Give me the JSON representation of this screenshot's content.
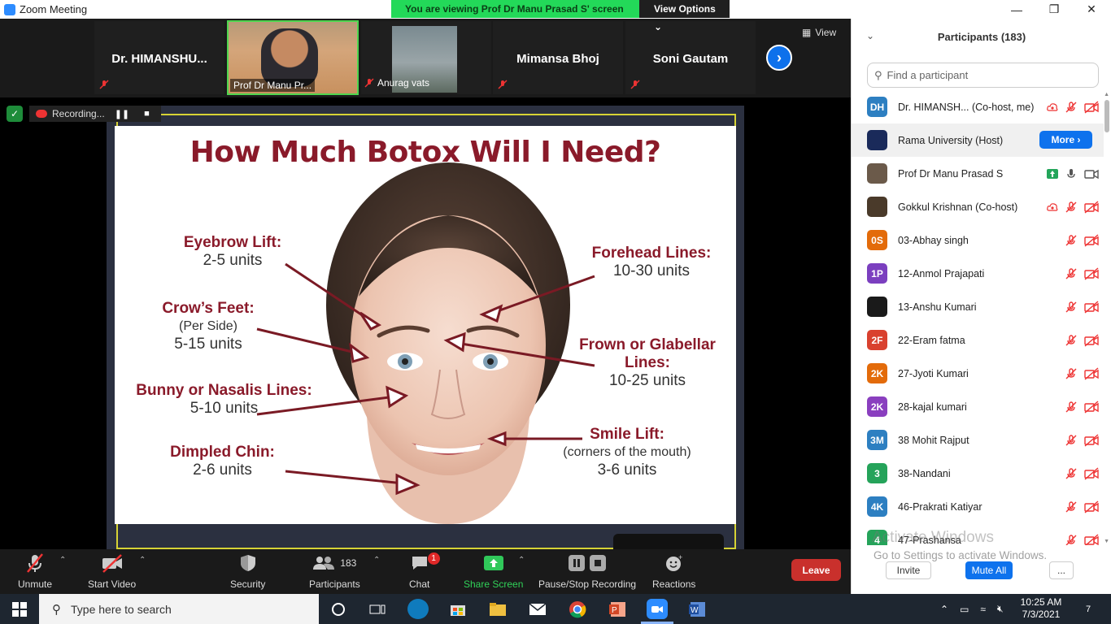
{
  "window": {
    "title": "Zoom Meeting",
    "viewing_banner": "You are viewing Prof Dr Manu Prasad S' screen",
    "view_options": "View Options"
  },
  "thumbnails": {
    "tiles": [
      {
        "name": "Dr.  HIMANSHU..."
      },
      {
        "name": "Prof Dr Manu Pr..."
      },
      {
        "name": "Anurag vats"
      },
      {
        "name": "Mimansa Bhoj"
      },
      {
        "name": "Soni Gautam"
      }
    ],
    "view_label": "View"
  },
  "recording": {
    "label": "Recording..."
  },
  "slide": {
    "title": "How Much Botox Will I Need?",
    "callouts": [
      {
        "title": "Eyebrow Lift:",
        "sub": "",
        "units": "2-5 units"
      },
      {
        "title": "Crow’s Feet:",
        "sub": "(Per Side)",
        "units": "5-15 units"
      },
      {
        "title": "Bunny or Nasalis Lines:",
        "sub": "",
        "units": "5-10 units"
      },
      {
        "title": "Dimpled Chin:",
        "sub": "",
        "units": "2-6 units"
      },
      {
        "title": "Forehead Lines:",
        "sub": "",
        "units": "10-30 units"
      },
      {
        "title": "Frown or Glabellar Lines:",
        "sub": "",
        "units": "10-25 units"
      },
      {
        "title": "Smile Lift:",
        "sub": "(corners of the mouth)",
        "units": "3-6 units"
      }
    ]
  },
  "toolbar": {
    "unmute": "Unmute",
    "start_video": "Start Video",
    "security": "Security",
    "participants": "Participants",
    "participants_count": "183",
    "chat": "Chat",
    "chat_badge": "1",
    "share_screen": "Share Screen",
    "recording": "Pause/Stop Recording",
    "reactions": "Reactions",
    "leave": "Leave"
  },
  "panel": {
    "title": "Participants (183)",
    "search_placeholder": "Find a participant",
    "more_label": "More",
    "participants": [
      {
        "initials": "DH",
        "color": "#2d7fc1",
        "name": "Dr. HIMANSH... (Co-host, me)"
      },
      {
        "initials": "",
        "color": "#1a2a5a",
        "name": "Rama University (Host)"
      },
      {
        "initials": "",
        "color": "#6b5a4a",
        "name": "Prof Dr Manu Prasad S"
      },
      {
        "initials": "",
        "color": "#4a3a2a",
        "name": "Gokkul Krishnan (Co-host)"
      },
      {
        "initials": "0S",
        "color": "#e36b0a",
        "name": "03-Abhay singh"
      },
      {
        "initials": "1P",
        "color": "#7b3fbf",
        "name": "12-Anmol Prajapati"
      },
      {
        "initials": "",
        "color": "#1a1a1a",
        "name": "13-Anshu Kumari"
      },
      {
        "initials": "2F",
        "color": "#d9412f",
        "name": "22-Eram fatma"
      },
      {
        "initials": "2K",
        "color": "#e36b0a",
        "name": "27-Jyoti Kumari"
      },
      {
        "initials": "2K",
        "color": "#8a3fbf",
        "name": "28-kajal kumari"
      },
      {
        "initials": "3M",
        "color": "#2d7fc1",
        "name": "38 Mohit Rajput"
      },
      {
        "initials": "3",
        "color": "#25a35a",
        "name": "38-Nandani"
      },
      {
        "initials": "4K",
        "color": "#2d7fc1",
        "name": "46-Prakrati Katiyar"
      },
      {
        "initials": "4",
        "color": "#25a35a",
        "name": "47-Prashansa"
      }
    ],
    "watermark_title": "Activate Windows",
    "watermark_sub": "Go to Settings to activate Windows.",
    "invite": "Invite",
    "mute_all": "Mute All",
    "more_dots": "..."
  },
  "taskbar": {
    "search_placeholder": "Type here to search",
    "time": "10:25 AM",
    "date": "7/3/2021",
    "notifications": "7"
  }
}
